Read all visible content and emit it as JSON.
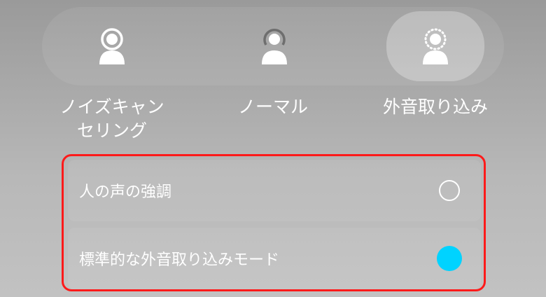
{
  "modes": [
    {
      "label": "ノイズキャン\nセリング",
      "icon": "person-ring-icon",
      "selected": false
    },
    {
      "label": "ノーマル",
      "icon": "person-partial-ring-icon",
      "selected": false
    },
    {
      "label": "外音取り込み",
      "icon": "person-dotted-ring-icon",
      "selected": true
    }
  ],
  "options": [
    {
      "label": "人の声の強調",
      "checked": false
    },
    {
      "label": "標準的な外音取り込みモード",
      "checked": true
    }
  ],
  "colors": {
    "accent": "#00d3ff",
    "highlight_border": "#ff1a1a"
  }
}
